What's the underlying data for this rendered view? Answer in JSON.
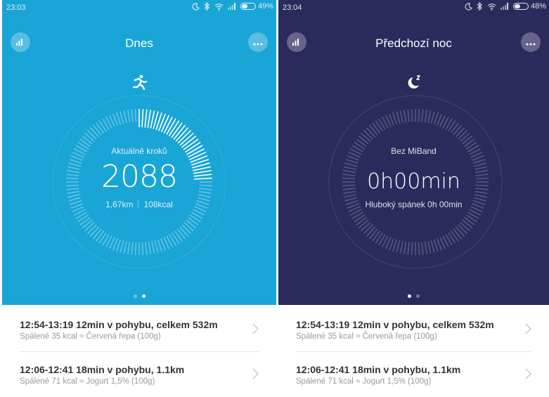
{
  "left_screen": {
    "status": {
      "time": "23:03",
      "battery": "49%",
      "battery_level": 0.49
    },
    "title": "Dnes",
    "label": "Aktuálně kroků",
    "value": "2088",
    "distance": "1,67km",
    "calories": "108kcal",
    "progress_fraction": 0.25,
    "pager": {
      "pages": 2,
      "active": 1
    },
    "accent_color": "#19a5d6",
    "top_icon": "running-person-icon"
  },
  "right_screen": {
    "status": {
      "time": "23:04",
      "battery": "48%",
      "battery_level": 0.48
    },
    "title": "Předchozí noc",
    "label": "Bez MiBand",
    "value": "0h00min",
    "deep_sleep": "Hluboký spánek 0h 00min",
    "pager": {
      "pages": 2,
      "active": 0
    },
    "accent_color": "#2b2a5c",
    "top_icon": "moon-sleep-icon"
  },
  "activities": [
    {
      "title": "12:54-13:19  12min v pohybu, celkem 532m",
      "subtitle": "Spálené 35 kcal ≈ Červená řepa (100g)"
    },
    {
      "title": "12:06-12:41  18min v pohybu, 1.1km",
      "subtitle": "Spálené 71 kcal ≈ Jogurt 1,5% (100g)"
    }
  ]
}
